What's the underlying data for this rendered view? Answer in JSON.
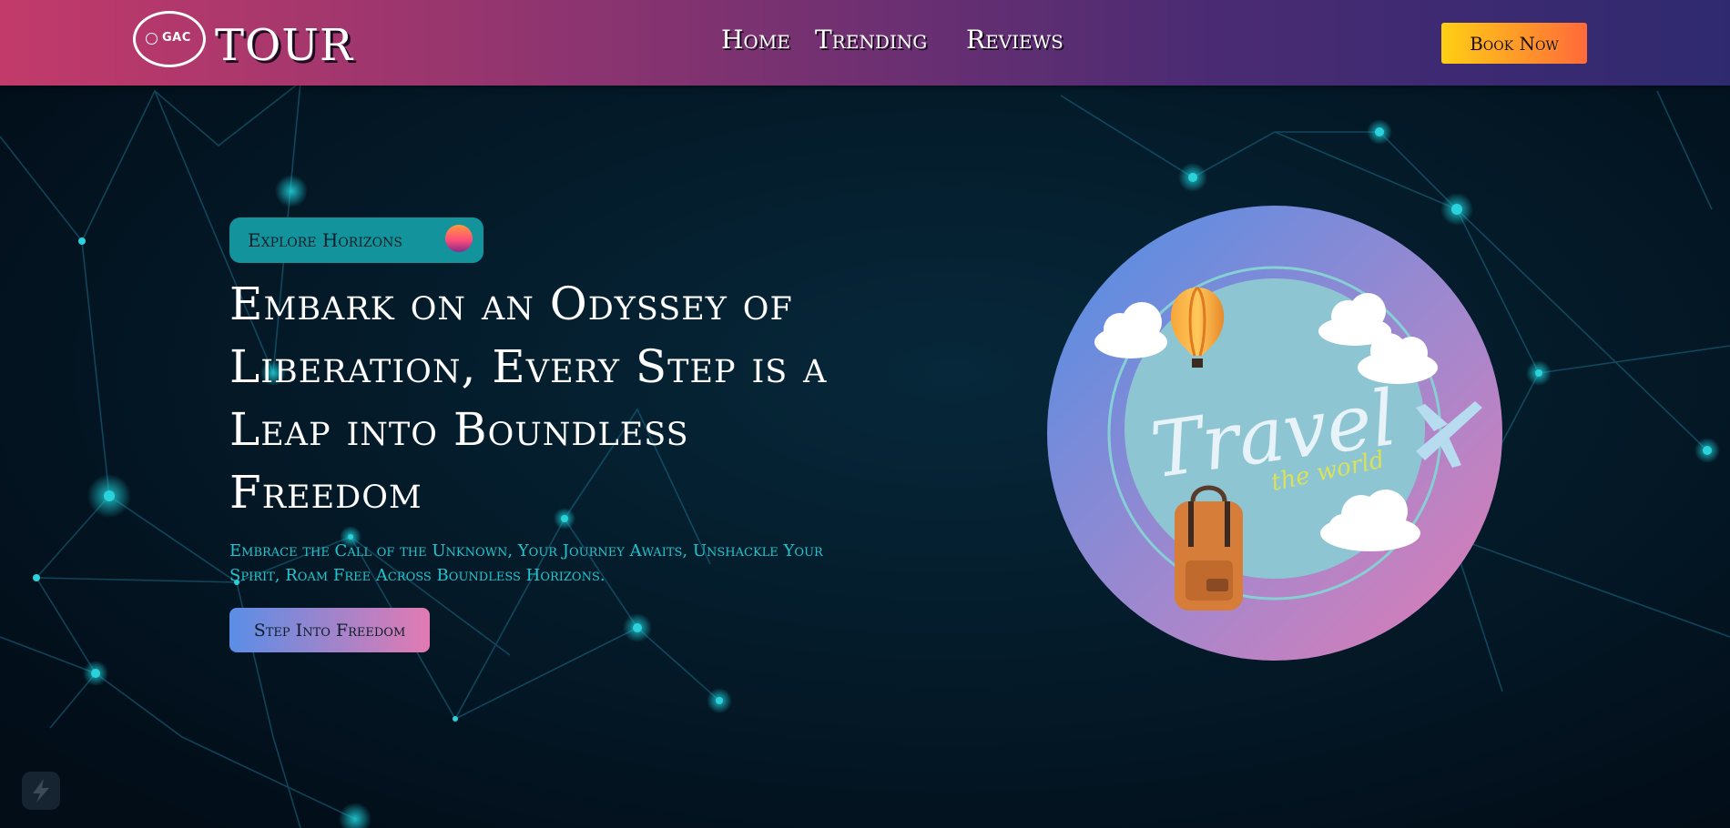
{
  "nav": {
    "logo_badge": "GAC",
    "logo_word": "TOUR",
    "links": [
      "Home",
      "Trending",
      "Reviews"
    ],
    "book_label": "Book Now"
  },
  "hero": {
    "badge": "Explore Horizons",
    "headline": "Embark on an Odyssey of Liberation, Every Step is a Leap into Boundless Freedom",
    "subtext": "Embrace the Call of the Unknown, Your Journey Awaits, Unshackle Your Spirit, Roam Free Across Boundless Horizons.",
    "cta": "Step Into Freedom"
  },
  "illustration": {
    "title": "Travel",
    "subtitle": "the world"
  },
  "colors": {
    "nav_gradient": [
      "#c23a6a",
      "#2f2a70"
    ],
    "book_gradient": [
      "#ffcf14",
      "#ff6a3a"
    ],
    "badge": "#13949c",
    "subtext": "#1fc6cf",
    "cta_gradient": [
      "#5a8ee6",
      "#e27ab2"
    ],
    "background": "#031524"
  }
}
